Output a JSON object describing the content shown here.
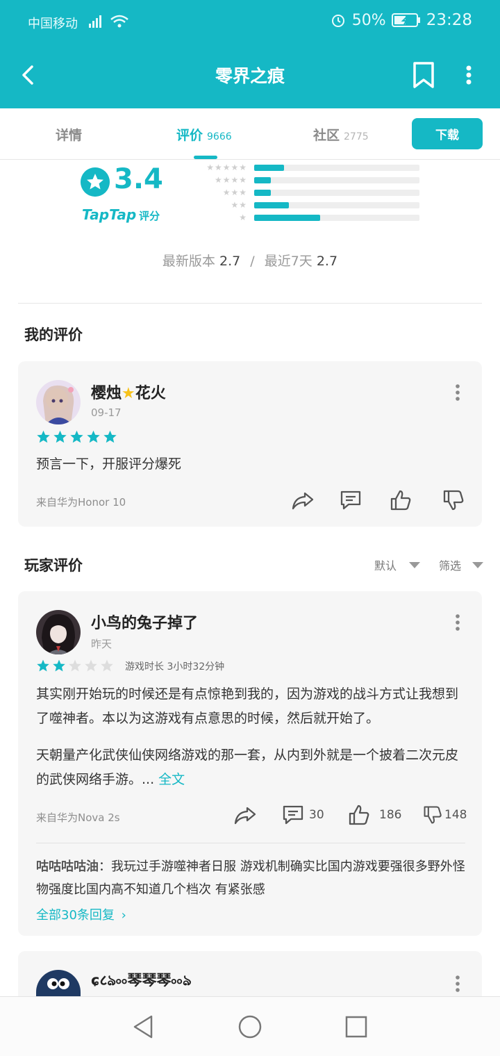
{
  "status_bar": {
    "carrier": "中国移动",
    "battery": "50%",
    "time": "23:28"
  },
  "app_bar": {
    "title": "零界之痕",
    "icons": [
      "back-arrow-icon",
      "bookmark-icon",
      "more-vertical-icon"
    ]
  },
  "tabs": [
    {
      "label": "详情",
      "count": ""
    },
    {
      "label": "评价",
      "count": "9666"
    },
    {
      "label": "社区",
      "count": "2775"
    }
  ],
  "download_label": "下载",
  "rating": {
    "score": "3.4",
    "brand": "TapTap",
    "brand_sub": "评分",
    "distribution": [
      {
        "stars": 5,
        "fraction": 0.18
      },
      {
        "stars": 4,
        "fraction": 0.1
      },
      {
        "stars": 3,
        "fraction": 0.1
      },
      {
        "stars": 2,
        "fraction": 0.21
      },
      {
        "stars": 1,
        "fraction": 0.4
      }
    ],
    "latest_label": "最新版本",
    "latest_value": "2.7",
    "separator": "/",
    "recent_label": "最近7天",
    "recent_value": "2.7"
  },
  "my_review": {
    "section_title": "我的评价",
    "name_a": "樱烛",
    "name_b": "花火",
    "date": "09-17",
    "stars": 5,
    "text": "预言一下，开服评分爆死",
    "device": "来自华为Honor 10"
  },
  "player_reviews": {
    "section_title": "玩家评价",
    "sort_label": "默认",
    "filter_label": "筛选",
    "review1": {
      "name": "小鸟的兔子掉了",
      "date": "昨天",
      "stars": 2,
      "playtime": "游戏时长 3小时32分钟",
      "para1": "其实刚开始玩的时候还是有点惊艳到我的，因为游戏的战斗方式让我想到了噬神者。本以为这游戏有点意思的时候，然后就开始了。",
      "para2": "天朝量产化武侠仙侠网络游戏的那一套，从内到外就是一个披着二次元皮的武侠网络手游。...",
      "more": "全文",
      "device": "来自华为Nova 2s",
      "comments": "30",
      "likes": "186",
      "dislikes": "148",
      "reply_author": "咕咕咕咕油",
      "reply_text": "：我玩过手游噬神者日服 游戏机制确实比国内游戏要强很多野外怪物强度比国内高不知道几个档次 有紧张感",
      "all_replies": "全部30条回复"
    },
    "review2": {
      "name": "ɕ८ঌ৹৹琴琴琴৹৹ঌ"
    }
  },
  "colors": {
    "accent": "#15b8c5",
    "star_off": "#dddddd",
    "card_bg": "#f6f6f6"
  }
}
